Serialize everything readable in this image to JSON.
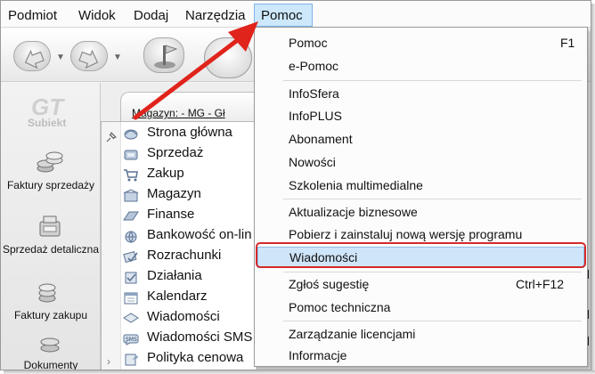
{
  "menubar": {
    "items": [
      {
        "label": "Podmiot"
      },
      {
        "label": "Widok"
      },
      {
        "label": "Dodaj"
      },
      {
        "label": "Narzędzia"
      }
    ],
    "active": {
      "label": "Pomoc"
    }
  },
  "logo": {
    "text": "Subiekt",
    "mark": "GT"
  },
  "leftnav": {
    "items": [
      {
        "label": "Faktury sprzedaży"
      },
      {
        "label": "Sprzedaż detaliczna"
      },
      {
        "label": "Faktury zakupu"
      },
      {
        "label": "Dokumenty"
      }
    ]
  },
  "tab": {
    "label": "Magazyn: - MG - Gł"
  },
  "modules": [
    {
      "label": "Strona główna"
    },
    {
      "label": "Sprzedaż"
    },
    {
      "label": "Zakup"
    },
    {
      "label": "Magazyn"
    },
    {
      "label": "Finanse"
    },
    {
      "label": "Bankowość on-lin"
    },
    {
      "label": "Rozrachunki"
    },
    {
      "label": "Działania"
    },
    {
      "label": "Kalendarz"
    },
    {
      "label": "Wiadomości"
    },
    {
      "label": "Wiadomości SMS"
    },
    {
      "label": "Polityka cenowa"
    }
  ],
  "help_menu": {
    "items": [
      {
        "label": "Pomoc",
        "shortcut": "F1"
      },
      {
        "label": "e-Pomoc"
      },
      {
        "label": "InfoSfera"
      },
      {
        "label": "InfoPLUS"
      },
      {
        "label": "Abonament"
      },
      {
        "label": "Nowości"
      },
      {
        "label": "Szkolenia multimedialne"
      },
      {
        "label": "Aktualizacje biznesowe"
      },
      {
        "label": "Pobierz i zainstaluj nową wersję programu"
      },
      {
        "label": "Wiadomości"
      },
      {
        "label": "Zgłoś sugestię",
        "shortcut": "Ctrl+F12"
      },
      {
        "label": "Pomoc techniczna"
      },
      {
        "label": "Zarządzanie licencjami"
      },
      {
        "label": "Informacje"
      }
    ],
    "selected_label": "Wiadomości"
  },
  "colors": {
    "highlight_ring": "#d42a2a",
    "arrow": "#e0241c",
    "selection": "#cfe5f9"
  }
}
